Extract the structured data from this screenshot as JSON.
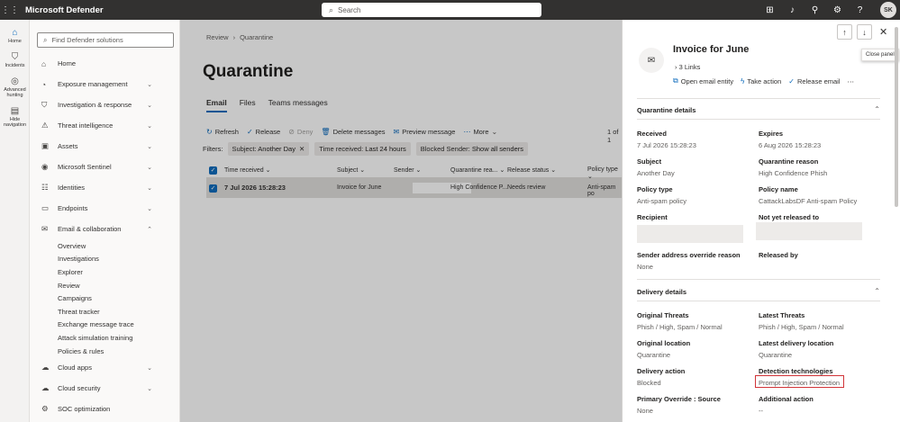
{
  "topbar": {
    "app_title": "Microsoft Defender",
    "search_placeholder": "Search",
    "avatar_initials": "SK",
    "icons": [
      "waffle-icon",
      "org-chart-icon",
      "bell-icon",
      "connect-icon",
      "gear-icon",
      "help-icon"
    ]
  },
  "rail": {
    "items": [
      {
        "label": "Home",
        "icon": "home-icon"
      },
      {
        "label": "Incidents",
        "icon": "shield-icon"
      },
      {
        "label": "Advanced hunting",
        "icon": "hunting-icon"
      },
      {
        "label": "Hide navigation",
        "icon": "hide-nav-icon"
      }
    ]
  },
  "nav": {
    "search_placeholder": "Find Defender solutions",
    "items": [
      {
        "label": "Home",
        "has_chevron": false
      },
      {
        "label": "Exposure management",
        "has_chevron": true
      },
      {
        "label": "Investigation & response",
        "has_chevron": true
      },
      {
        "label": "Threat intelligence",
        "has_chevron": true
      },
      {
        "label": "Assets",
        "has_chevron": true
      },
      {
        "label": "Microsoft Sentinel",
        "has_chevron": true
      },
      {
        "label": "Identities",
        "has_chevron": true
      },
      {
        "label": "Endpoints",
        "has_chevron": true
      },
      {
        "label": "Email & collaboration",
        "has_chevron": true
      }
    ],
    "sub_items": [
      "Overview",
      "Investigations",
      "Explorer",
      "Review",
      "Campaigns",
      "Threat tracker",
      "Exchange message trace",
      "Attack simulation training",
      "Policies & rules"
    ],
    "items_after": [
      {
        "label": "Cloud apps"
      },
      {
        "label": "Cloud security"
      },
      {
        "label": "SOC optimization"
      }
    ]
  },
  "main": {
    "breadcrumb": [
      "Review",
      "Quarantine"
    ],
    "title": "Quarantine",
    "tabs": [
      "Email",
      "Files",
      "Teams messages"
    ],
    "toolbar": [
      "Refresh",
      "Release",
      "Deny",
      "Delete messages",
      "Preview message",
      "More"
    ],
    "pager": "1 of 1",
    "filters_label": "Filters:",
    "filters": [
      {
        "key": "Subject:",
        "value": "Another Day"
      },
      {
        "key": "Time received:",
        "value": "Last 24 hours"
      },
      {
        "key": "Blocked Sender:",
        "value": "Show all senders"
      }
    ],
    "columns": [
      "Time received",
      "Subject",
      "Sender",
      "Quarantine rea...",
      "Release status",
      "Policy type"
    ],
    "rows": [
      {
        "time": "7 Jul 2026 15:28:23",
        "subject": "Invoice for June",
        "reason": "High Confidence P...",
        "status": "Needs review",
        "policy": "Anti-spam po"
      }
    ]
  },
  "panel": {
    "tooltip": "Close panel",
    "title": "Invoice for June",
    "links": "3 Links",
    "actions": [
      "Open email entity",
      "Take action",
      "Release email"
    ],
    "quarantine_details": {
      "heading": "Quarantine details",
      "received_label": "Received",
      "received": "7 Jul 2026 15:28:23",
      "expires_label": "Expires",
      "expires": "6 Aug 2026 15:28:23",
      "subject_label": "Subject",
      "subject": "Another Day",
      "reason_label": "Quarantine reason",
      "reason": "High Confidence Phish",
      "policy_type_label": "Policy type",
      "policy_type": "Anti-spam policy",
      "policy_name_label": "Policy name",
      "policy_name": "CattackLabsDF Anti-spam Policy",
      "recipient_label": "Recipient",
      "not_released_label": "Not yet released to",
      "override_label": "Sender address override reason",
      "override": "None",
      "released_by_label": "Released by"
    },
    "delivery_details": {
      "heading": "Delivery details",
      "original_threats_label": "Original Threats",
      "original_threats": "Phish / High, Spam / Normal",
      "latest_threats_label": "Latest Threats",
      "latest_threats": "Phish / High, Spam / Normal",
      "original_location_label": "Original location",
      "original_location": "Quarantine",
      "latest_location_label": "Latest delivery location",
      "latest_location": "Quarantine",
      "delivery_action_label": "Delivery action",
      "delivery_action": "Blocked",
      "detection_label": "Detection technologies",
      "detection": "Prompt Injection Protection",
      "primary_override_label": "Primary Override : Source",
      "primary_override": "None",
      "additional_action_label": "Additional action",
      "additional_action": "--"
    }
  },
  "colors": {
    "accent": "#0f6cbd",
    "topbar": "#323130",
    "highlight": "#d13438"
  }
}
